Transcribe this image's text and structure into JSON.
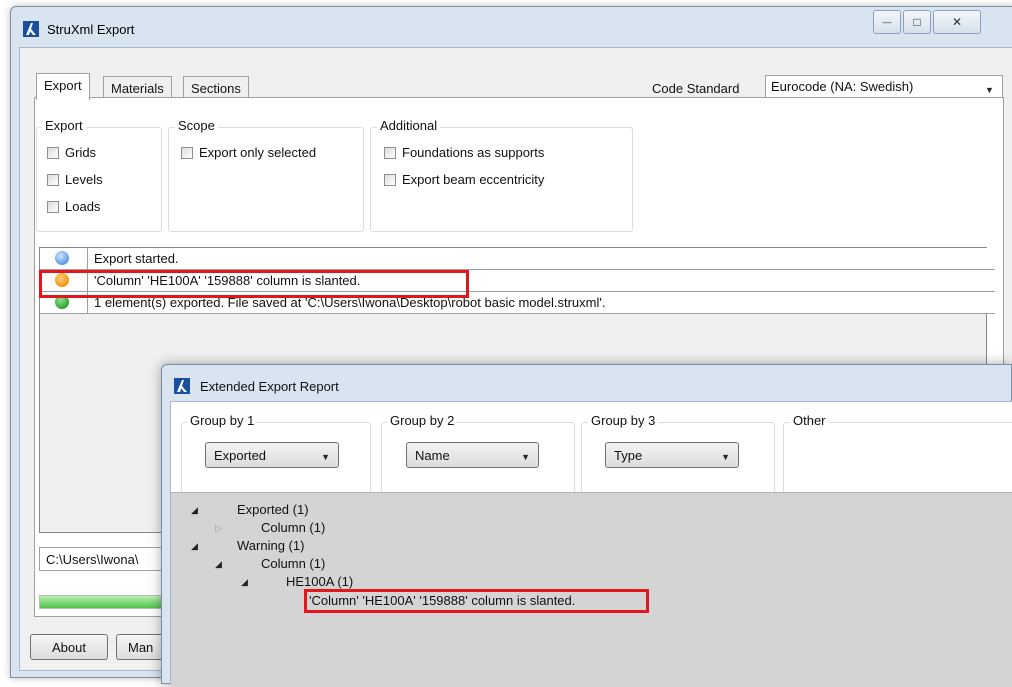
{
  "main_window": {
    "title": "StruXml Export",
    "caption_buttons": {
      "minimize": "—",
      "maximize": "□",
      "close": "✕"
    }
  },
  "tabs": [
    {
      "label": "Export",
      "active": true
    },
    {
      "label": "Materials",
      "active": false
    },
    {
      "label": "Sections",
      "active": false
    }
  ],
  "code_standard": {
    "label": "Code Standard",
    "value": "Eurocode (NA: Swedish)"
  },
  "groups": {
    "export": {
      "title": "Export",
      "items": [
        "Grids",
        "Levels",
        "Loads"
      ]
    },
    "scope": {
      "title": "Scope",
      "items": [
        "Export only selected"
      ]
    },
    "additional": {
      "title": "Additional",
      "items": [
        "Foundations as supports",
        "Export beam eccentricity"
      ]
    }
  },
  "log": [
    {
      "status": "info",
      "color": "#5a9be0",
      "text": "Export started."
    },
    {
      "status": "warning",
      "color": "#f39412",
      "text": "'Column' 'HE100A' '159888' column is slanted."
    },
    {
      "status": "success",
      "color": "#2ea52e",
      "text": "1 element(s) exported. File saved at 'C:\\Users\\Iwona\\Desktop\\robot basic model.struxml'."
    }
  ],
  "path_field": {
    "value": "C:\\Users\\Iwona\\"
  },
  "progress": {
    "percent": 100
  },
  "buttons": {
    "about": "About",
    "manual": "Man"
  },
  "report_window": {
    "title": "Extended Export Report",
    "group_by": [
      {
        "title": "Group by 1",
        "value": "Exported"
      },
      {
        "title": "Group by 2",
        "value": "Name"
      },
      {
        "title": "Group by 3",
        "value": "Type"
      }
    ],
    "other": {
      "title": "Other"
    },
    "tree": [
      {
        "label": "Exported (1)",
        "expanded": true
      },
      {
        "label": "Column (1)",
        "expanded": false
      },
      {
        "label": "Warning (1)",
        "expanded": true
      },
      {
        "label": "Column (1)",
        "expanded": true
      },
      {
        "label": "HE100A (1)",
        "expanded": true
      },
      {
        "label": "'Column' 'HE100A' '159888' column is slanted."
      }
    ]
  },
  "colors": {
    "highlight": "#e2161b",
    "window_frame": "#d9e4f1"
  }
}
